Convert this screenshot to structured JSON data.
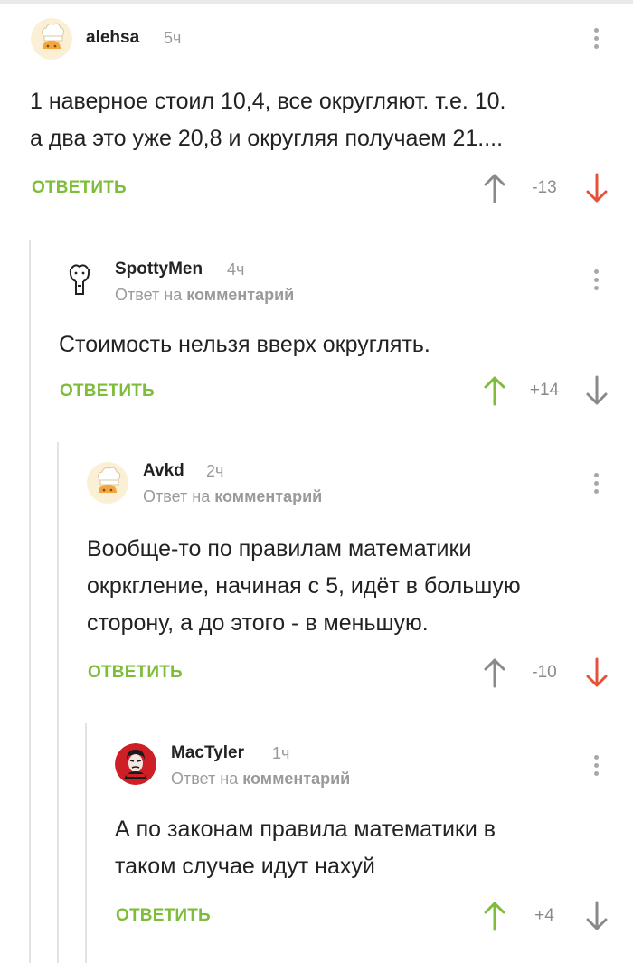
{
  "colors": {
    "accent_green": "#7ebd3a",
    "vote_down_red": "#e8503a",
    "neutral_gray": "#8a8a8a",
    "thread_line": "#e4e4e4"
  },
  "comments": [
    {
      "author": "alehsa",
      "time": "5ч",
      "avatar": "chef-hat-avatar",
      "reply_to": null,
      "body": [
        "1 наверное стоил 10,4, все округляют. т.е. 10.",
        "а два это уже 20,8 и округляя получаем 21...."
      ],
      "reply_label": "ОТВЕТИТЬ",
      "score": "-13",
      "vote": "down"
    },
    {
      "author": "SpottyMen",
      "time": "4ч",
      "avatar": "stick-figure-avatar",
      "reply_to": {
        "prefix": "Ответ на",
        "target": "комментарий"
      },
      "body": [
        "Стоимость нельзя вверх округлять."
      ],
      "reply_label": "ОТВЕТИТЬ",
      "score": "+14",
      "vote": "up"
    },
    {
      "author": "Avkd",
      "time": "2ч",
      "avatar": "chef-hat-avatar",
      "reply_to": {
        "prefix": "Ответ на",
        "target": "комментарий"
      },
      "body": [
        "Вообще-то по правилам математики",
        "окркгление, начиная с 5, идёт в большую",
        "сторону, а до этого - в меньшую."
      ],
      "reply_label": "ОТВЕТИТЬ",
      "score": "-10",
      "vote": "down"
    },
    {
      "author": "MacTyler",
      "time": "1ч",
      "avatar": "red-portrait-avatar",
      "reply_to": {
        "prefix": "Ответ на",
        "target": "комментарий"
      },
      "body": [
        "А по законам правила математики в",
        "таком случае идут нахуй"
      ],
      "reply_label": "ОТВЕТИТЬ",
      "score": "+4",
      "vote": "up"
    }
  ]
}
